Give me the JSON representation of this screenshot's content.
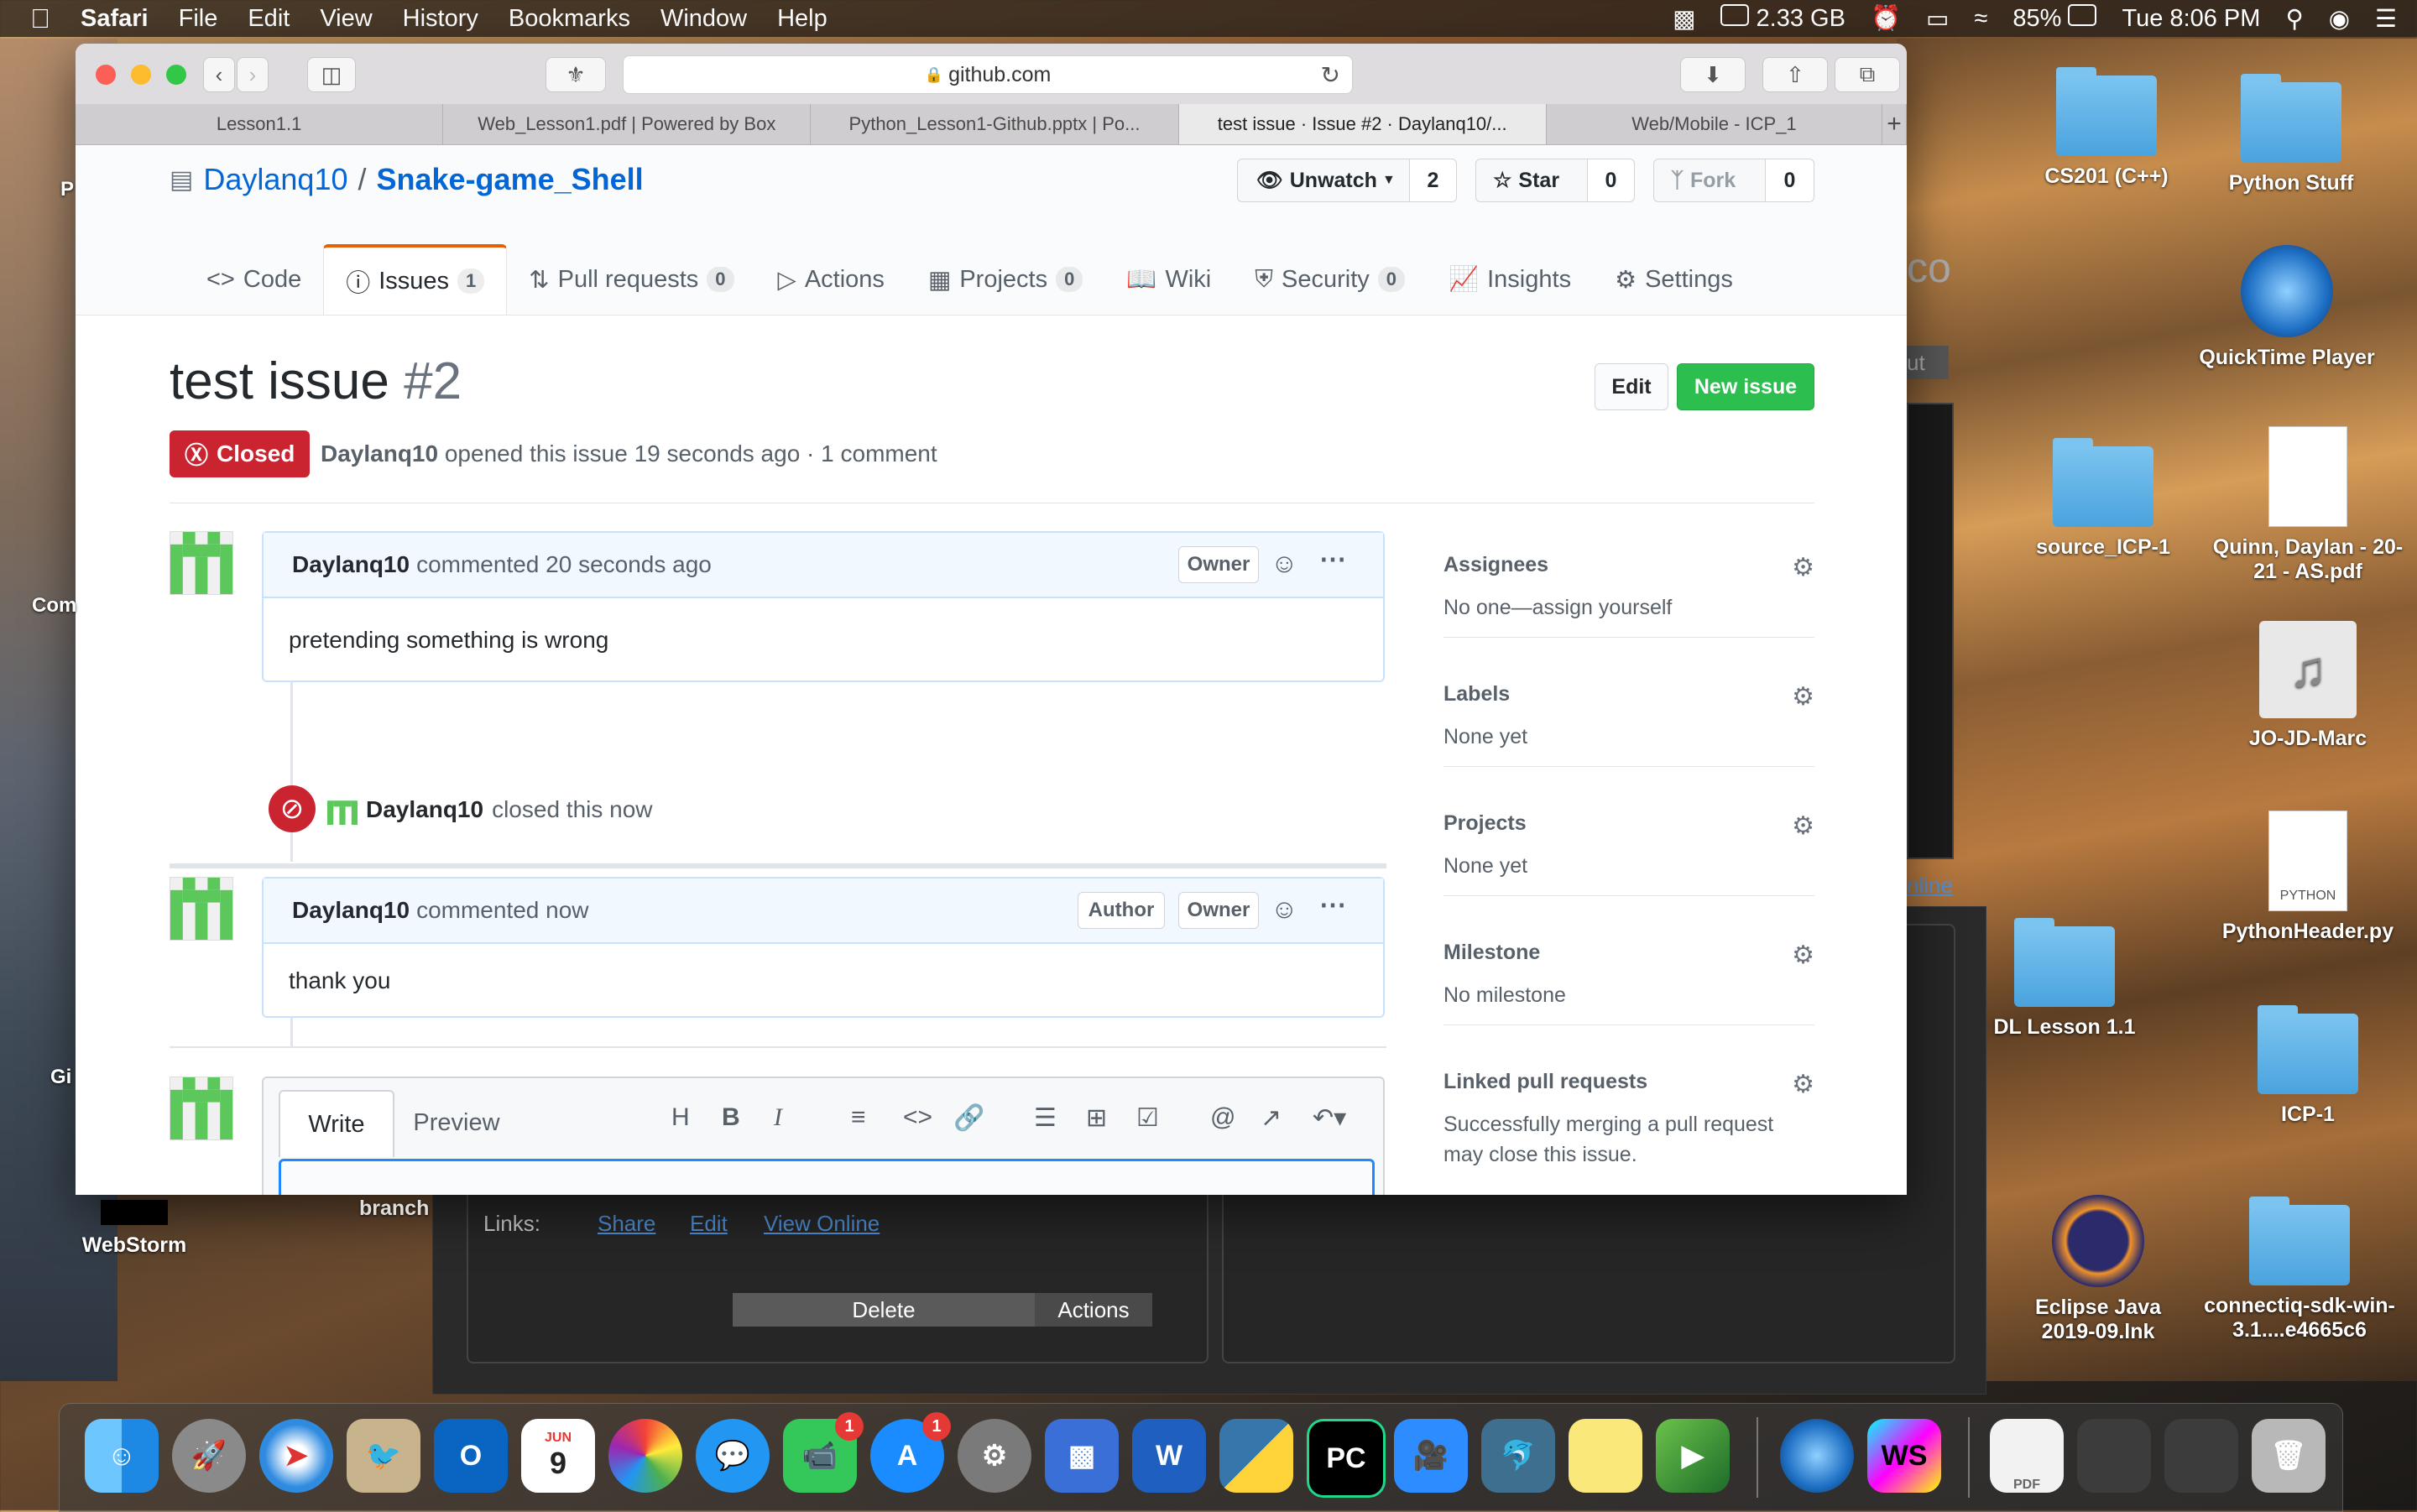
{
  "menubar": {
    "app": "Safari",
    "items": [
      "File",
      "Edit",
      "View",
      "History",
      "Bookmarks",
      "Window",
      "Help"
    ],
    "memory": "2.33 GB",
    "battery": "85%",
    "clock": "Tue 8:06 PM"
  },
  "browser": {
    "address": "github.com",
    "tabs": [
      "Lesson1.1",
      "Web_Lesson1.pdf | Powered by Box",
      "Python_Lesson1-Github.pptx | Po...",
      "test issue · Issue #2 · Daylanq10/...",
      "Web/Mobile - ICP_1"
    ],
    "new_tab": "+"
  },
  "repo": {
    "owner": "Daylanq10",
    "separator": "/",
    "name": "Snake-game_Shell",
    "unwatch_label": "Unwatch",
    "unwatch_count": "2",
    "star_label": "Star",
    "star_count": "0",
    "fork_label": "Fork",
    "fork_count": "0"
  },
  "nav": {
    "code": "Code",
    "issues": "Issues",
    "issues_count": "1",
    "pulls": "Pull requests",
    "pulls_count": "0",
    "actions": "Actions",
    "projects": "Projects",
    "projects_count": "0",
    "wiki": "Wiki",
    "security": "Security",
    "security_count": "0",
    "insights": "Insights",
    "settings": "Settings"
  },
  "issue": {
    "title": "test issue",
    "number": "#2",
    "edit_label": "Edit",
    "new_issue_label": "New issue",
    "state": "Closed",
    "author": "Daylanq10",
    "meta_text": "opened this issue 19 seconds ago · 1 comment"
  },
  "timeline": {
    "comment1": {
      "author": "Daylanq10",
      "action": "commented 20 seconds ago",
      "owner_label": "Owner",
      "body": "pretending something is wrong"
    },
    "event": {
      "author": "Daylanq10",
      "action": "closed this now"
    },
    "comment2": {
      "author": "Daylanq10",
      "action": "commented now",
      "author_label": "Author",
      "owner_label": "Owner",
      "body": "thank you"
    }
  },
  "editor": {
    "write_tab": "Write",
    "preview_tab": "Preview"
  },
  "sidebar": {
    "assignees_title": "Assignees",
    "assignees_value": "No one—assign yourself",
    "labels_title": "Labels",
    "labels_value": "None yet",
    "projects_title": "Projects",
    "projects_value": "None yet",
    "milestone_title": "Milestone",
    "milestone_value": "No milestone",
    "linked_title": "Linked pull requests",
    "linked_value": "Successfully merging a pull request may close this issue."
  },
  "back_window": {
    "links_label": "Links:",
    "share": "Share",
    "edit": "Edit",
    "view_online": "View Online",
    "delete_label": "Delete",
    "actions_label": "Actions",
    "partial_link": "nline",
    "partial_text": "ut",
    "partial_co": "co"
  },
  "desktop": {
    "icons": [
      "CS201 (C++)",
      "Python Stuff",
      "QuickTime Player",
      "source_ICP-1",
      "Quinn, Daylan - 20-21 - AS.pdf",
      "JO-JD-Marc",
      "PythonHeader.py",
      "DL Lesson 1.1",
      "ICP-1",
      "Eclipse Java 2019-09.lnk",
      "connectiq-sdk-win-3.1....e4665c6",
      "WebStorm",
      "branch"
    ],
    "left_partial": [
      "P",
      "Com",
      "Gi"
    ],
    "python_doc_tag": "PYTHON"
  },
  "dock": {
    "calendar_month": "JUN",
    "calendar_day": "9",
    "facetime_badge": "1",
    "appstore_badge": "1",
    "outlook_letter": "O",
    "word_letter": "W",
    "pycharm_letter": "PC",
    "webstorm_letter": "WS",
    "pdf_tag": "PDF"
  }
}
